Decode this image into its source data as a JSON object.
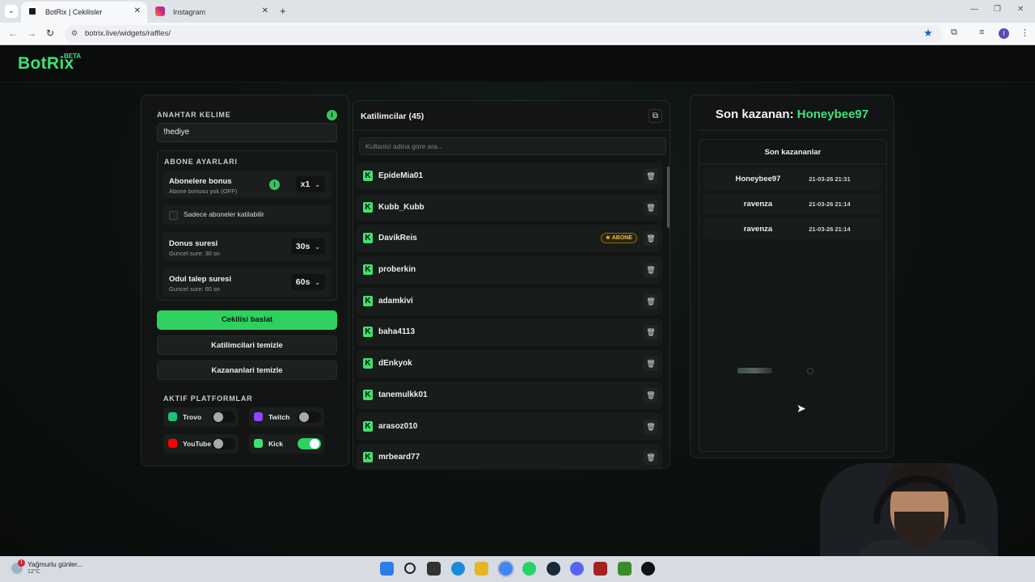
{
  "browser": {
    "tabs": [
      {
        "title": "BotRix | Cekilisler",
        "active": true
      },
      {
        "title": "Instagram",
        "active": false
      }
    ],
    "url": "botrix.live/widgets/raffles/"
  },
  "app": {
    "logo": "BotRix",
    "beta": "BETA"
  },
  "left": {
    "keyword_title": "ANAHTAR KELIME",
    "keyword_value": "!hediye",
    "sub_title": "ABONE AYARLARI",
    "bonus_label": "Abonelere bonus",
    "bonus_sub": "Abone bonusu yok (OFF)",
    "bonus_select": "x1",
    "subs_only_label": "Sadece aboneler katilabilir",
    "duration_label": "Donus suresi",
    "duration_sub": "Guncel sure: 30 sn",
    "duration_select": "30s",
    "claim_label": "Odul talep suresi",
    "claim_sub": "Guncel sure: 60 sn",
    "claim_select": "60s",
    "start_button": "Cekilisi baslat",
    "clear_participants_button": "Katilimcilari temizle",
    "clear_winners_button": "Kazananlari temizle",
    "platforms_title": "AKTIF PLATFORMLAR",
    "platforms": [
      {
        "label": "Trovo",
        "on": false,
        "color": "#1ec27a"
      },
      {
        "label": "Twitch",
        "on": false,
        "color": "#9146ff"
      },
      {
        "label": "YouTube",
        "on": false,
        "color": "#ff0000"
      },
      {
        "label": "Kick",
        "on": true,
        "color": "#3fe26e"
      }
    ]
  },
  "participants": {
    "title": "Katilimcilar (45)",
    "search_placeholder": "Kullanici adina gore ara...",
    "badge_label": "ABONE",
    "list": [
      {
        "name": "EpideMia01",
        "badge": false
      },
      {
        "name": "Kubb_Kubb",
        "badge": false
      },
      {
        "name": "DavikReis",
        "badge": true
      },
      {
        "name": "proberkin",
        "badge": false
      },
      {
        "name": "adamkivi",
        "badge": false
      },
      {
        "name": "baha4113",
        "badge": false
      },
      {
        "name": "dEnkyok",
        "badge": false
      },
      {
        "name": "tanemulkk01",
        "badge": false
      },
      {
        "name": "arasoz010",
        "badge": false
      },
      {
        "name": "mrbeard77",
        "badge": false
      }
    ]
  },
  "winners": {
    "last_winner_prefix": "Son kazanan:",
    "last_winner_name": "Honeybee97",
    "recent_title": "Son kazananlar",
    "list": [
      {
        "name": "Honeybee97",
        "date": "21-03-26 21:31"
      },
      {
        "name": "ravenza",
        "date": "21-03-26 21:14"
      },
      {
        "name": "ravenza",
        "date": "21-03-26 21:14"
      }
    ]
  },
  "taskbar": {
    "weather_text": "Yağmurlu günler...",
    "weather_temp": "12°C",
    "notification_count": "1"
  },
  "colors": {
    "accent": "#3ee07a",
    "button_green": "#2ed160",
    "badge_gold": "#e8c23a"
  }
}
